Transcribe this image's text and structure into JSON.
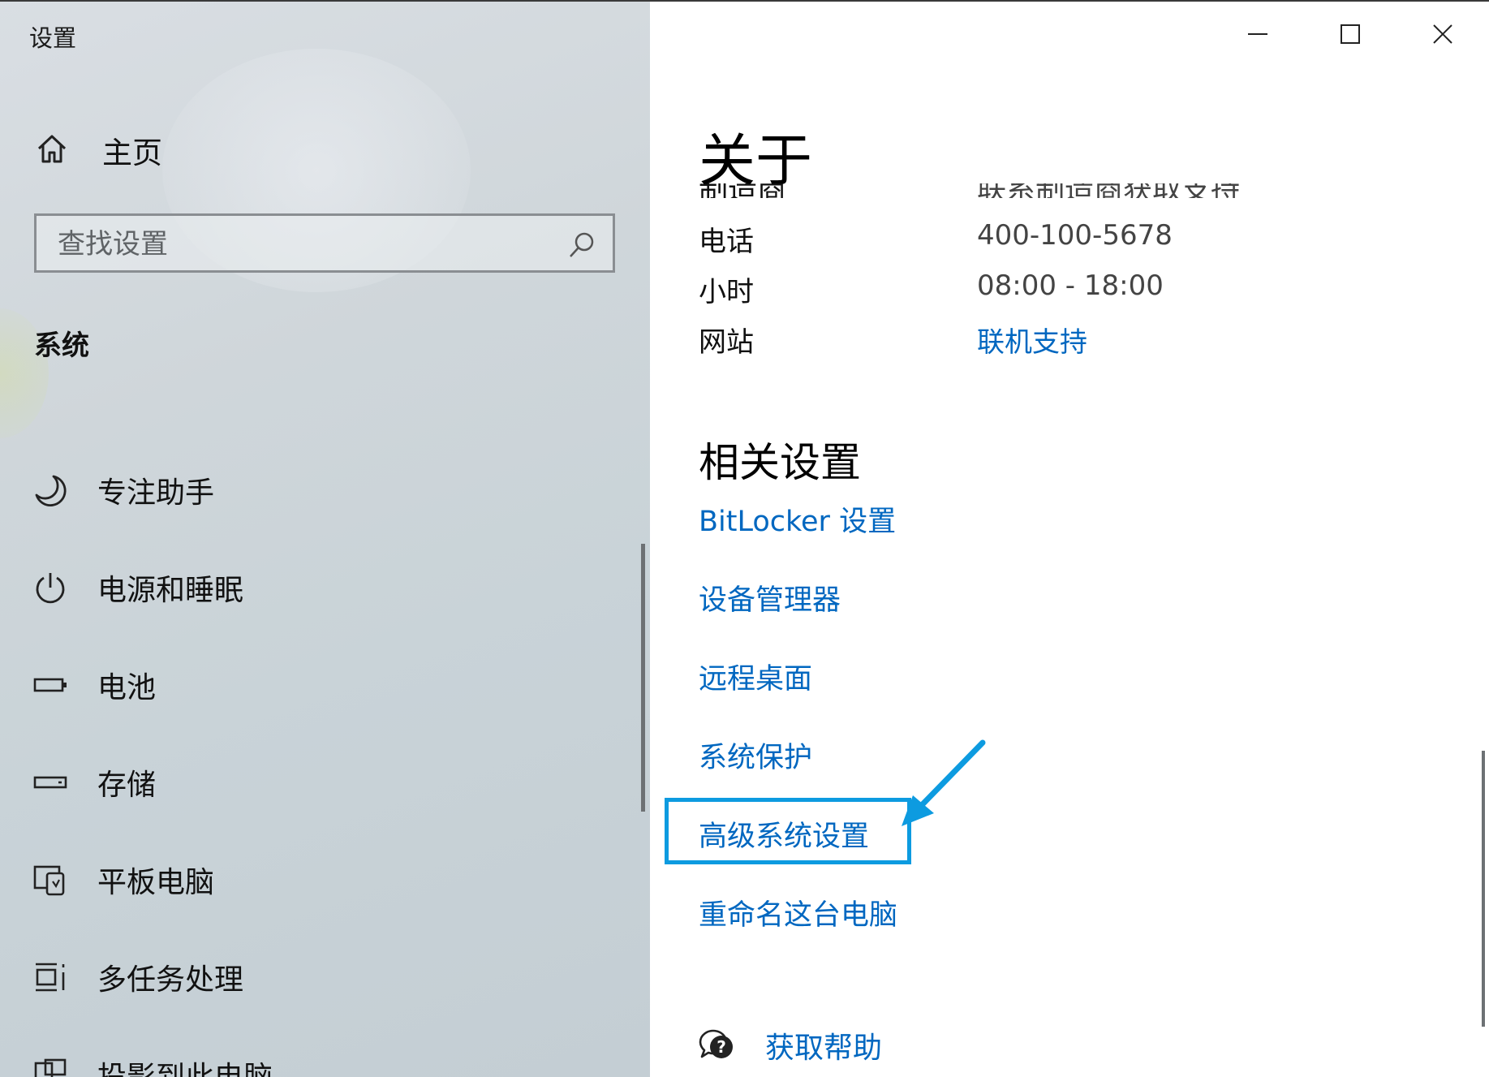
{
  "window": {
    "app_title": "设置"
  },
  "sidebar": {
    "home_label": "主页",
    "search_placeholder": "查找设置",
    "section_title": "系统",
    "items": [
      {
        "label": "专注助手",
        "icon": "moon-icon"
      },
      {
        "label": "电源和睡眠",
        "icon": "power-icon"
      },
      {
        "label": "电池",
        "icon": "battery-icon"
      },
      {
        "label": "存储",
        "icon": "storage-icon"
      },
      {
        "label": "平板电脑",
        "icon": "tablet-icon"
      },
      {
        "label": "多任务处理",
        "icon": "multitasking-icon"
      },
      {
        "label": "投影到此电脑",
        "icon": "project-icon"
      }
    ]
  },
  "main": {
    "title": "关于",
    "partial_row": {
      "key": "制造商",
      "value": "联系制造商获取支持"
    },
    "support_rows": [
      {
        "key": "电话",
        "value": "400-100-5678"
      },
      {
        "key": "小时",
        "value": "08:00 - 18:00"
      },
      {
        "key": "网站",
        "value": "联机支持"
      }
    ],
    "related_title": "相关设置",
    "related_links": [
      "BitLocker 设置",
      "设备管理器",
      "远程桌面",
      "系统保护",
      "高级系统设置",
      "重命名这台电脑"
    ],
    "highlighted_link": "高级系统设置",
    "help_label": "获取帮助"
  },
  "colors": {
    "link": "#0067c0",
    "highlight": "#0d9be0"
  }
}
